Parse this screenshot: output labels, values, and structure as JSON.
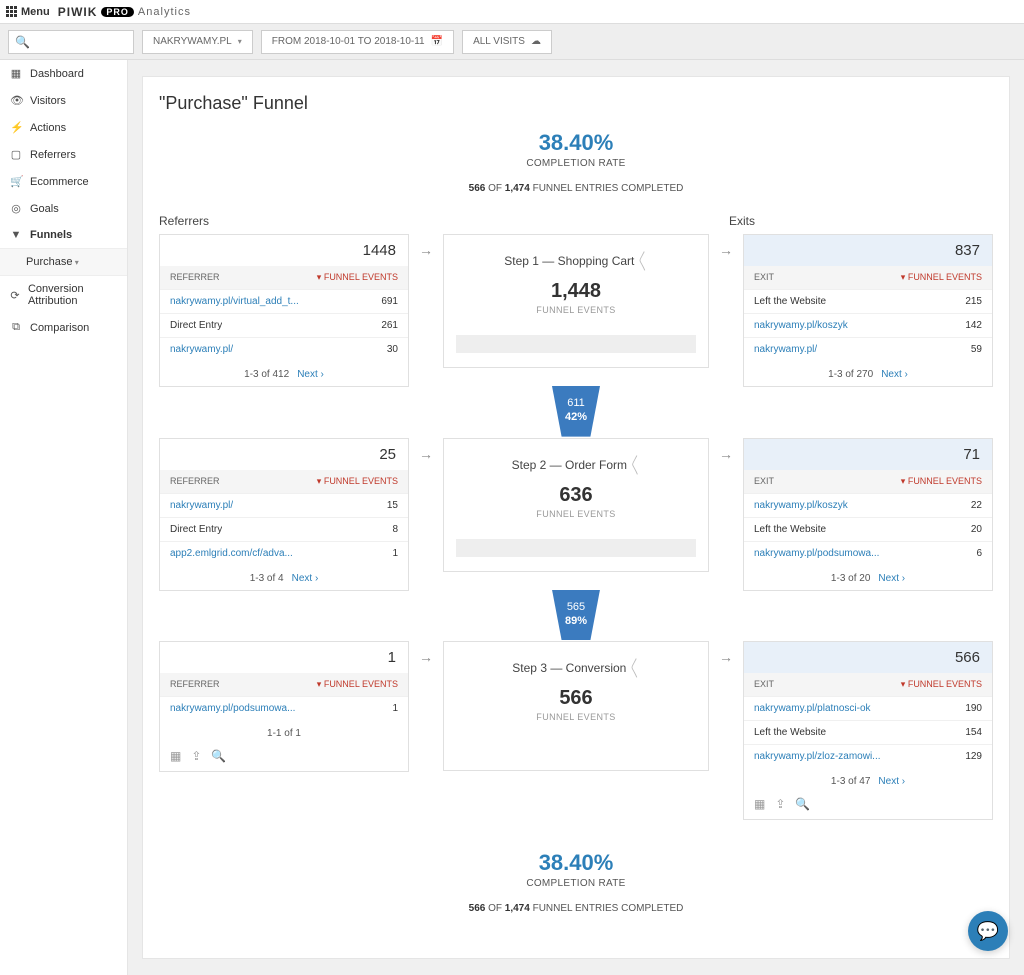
{
  "topbar": {
    "menu": "Menu",
    "brand": "PIWIK",
    "pro": "PRO",
    "sub": "Analytics"
  },
  "filters": {
    "site": "NAKRYWAMY.PL",
    "daterange": "FROM 2018-10-01 TO 2018-10-11",
    "segment": "ALL VISITS"
  },
  "nav": {
    "items": [
      {
        "icon": "▦",
        "label": "Dashboard"
      },
      {
        "icon": "👁",
        "label": "Visitors"
      },
      {
        "icon": "⚡",
        "label": "Actions"
      },
      {
        "icon": "▢",
        "label": "Referrers"
      },
      {
        "icon": "🛒",
        "label": "Ecommerce"
      },
      {
        "icon": "◎",
        "label": "Goals"
      },
      {
        "icon": "▼",
        "label": "Funnels"
      }
    ],
    "sub": "Purchase",
    "tail": [
      {
        "icon": "⟳",
        "label": "Conversion Attribution"
      },
      {
        "icon": "⧉",
        "label": "Comparison"
      }
    ]
  },
  "page": {
    "title": "\"Purchase\" Funnel",
    "summary": {
      "pct": "38.40%",
      "label": "COMPLETION RATE",
      "done": "566",
      "of": "1,474",
      "tail": "FUNNEL ENTRIES COMPLETED"
    },
    "referrers_label": "Referrers",
    "exits_label": "Exits",
    "col_ref": "REFERRER",
    "col_exit": "EXIT",
    "col_ev": "FUNNEL EVENTS",
    "next": "Next ›"
  },
  "steps": [
    {
      "ref_total": "1448",
      "ref_rows": [
        {
          "label": "nakrywamy.pl/virtual_add_t...",
          "link": true,
          "val": "691"
        },
        {
          "label": "Direct Entry",
          "link": false,
          "val": "261"
        },
        {
          "label": "nakrywamy.pl/",
          "link": true,
          "val": "30"
        }
      ],
      "ref_page": "1-3 of 412",
      "ref_next": true,
      "ref_icons": false,
      "center": {
        "name": "Step 1 — Shopping Cart",
        "count": "1,448",
        "label": "FUNNEL EVENTS",
        "bar": true
      },
      "exit_total": "837",
      "exit_rows": [
        {
          "label": "Left the Website",
          "link": false,
          "val": "215"
        },
        {
          "label": "nakrywamy.pl/koszyk",
          "link": true,
          "val": "142"
        },
        {
          "label": "nakrywamy.pl/",
          "link": true,
          "val": "59"
        }
      ],
      "exit_page": "1-3 of 270",
      "exit_next": true,
      "exit_icons": false,
      "connector": {
        "count": "611",
        "pct": "42%"
      }
    },
    {
      "ref_total": "25",
      "ref_rows": [
        {
          "label": "nakrywamy.pl/",
          "link": true,
          "val": "15"
        },
        {
          "label": "Direct Entry",
          "link": false,
          "val": "8"
        },
        {
          "label": "app2.emlgrid.com/cf/adva...",
          "link": true,
          "val": "1"
        }
      ],
      "ref_page": "1-3 of 4",
      "ref_next": true,
      "ref_icons": false,
      "center": {
        "name": "Step 2 — Order Form",
        "count": "636",
        "label": "FUNNEL EVENTS",
        "bar": true
      },
      "exit_total": "71",
      "exit_rows": [
        {
          "label": "nakrywamy.pl/koszyk",
          "link": true,
          "val": "22"
        },
        {
          "label": "Left the Website",
          "link": false,
          "val": "20"
        },
        {
          "label": "nakrywamy.pl/podsumowa...",
          "link": true,
          "val": "6"
        }
      ],
      "exit_page": "1-3 of 20",
      "exit_next": true,
      "exit_icons": false,
      "connector": {
        "count": "565",
        "pct": "89%"
      }
    },
    {
      "ref_total": "1",
      "ref_rows": [
        {
          "label": "nakrywamy.pl/podsumowa...",
          "link": true,
          "val": "1"
        }
      ],
      "ref_page": "1-1 of 1",
      "ref_next": false,
      "ref_icons": true,
      "center": {
        "name": "Step 3 — Conversion",
        "count": "566",
        "label": "FUNNEL EVENTS",
        "bar": false
      },
      "exit_total": "566",
      "exit_rows": [
        {
          "label": "nakrywamy.pl/platnosci-ok",
          "link": true,
          "val": "190"
        },
        {
          "label": "Left the Website",
          "link": false,
          "val": "154"
        },
        {
          "label": "nakrywamy.pl/zloz-zamowi...",
          "link": true,
          "val": "129"
        }
      ],
      "exit_page": "1-3 of 47",
      "exit_next": true,
      "exit_icons": true,
      "connector": null
    }
  ]
}
